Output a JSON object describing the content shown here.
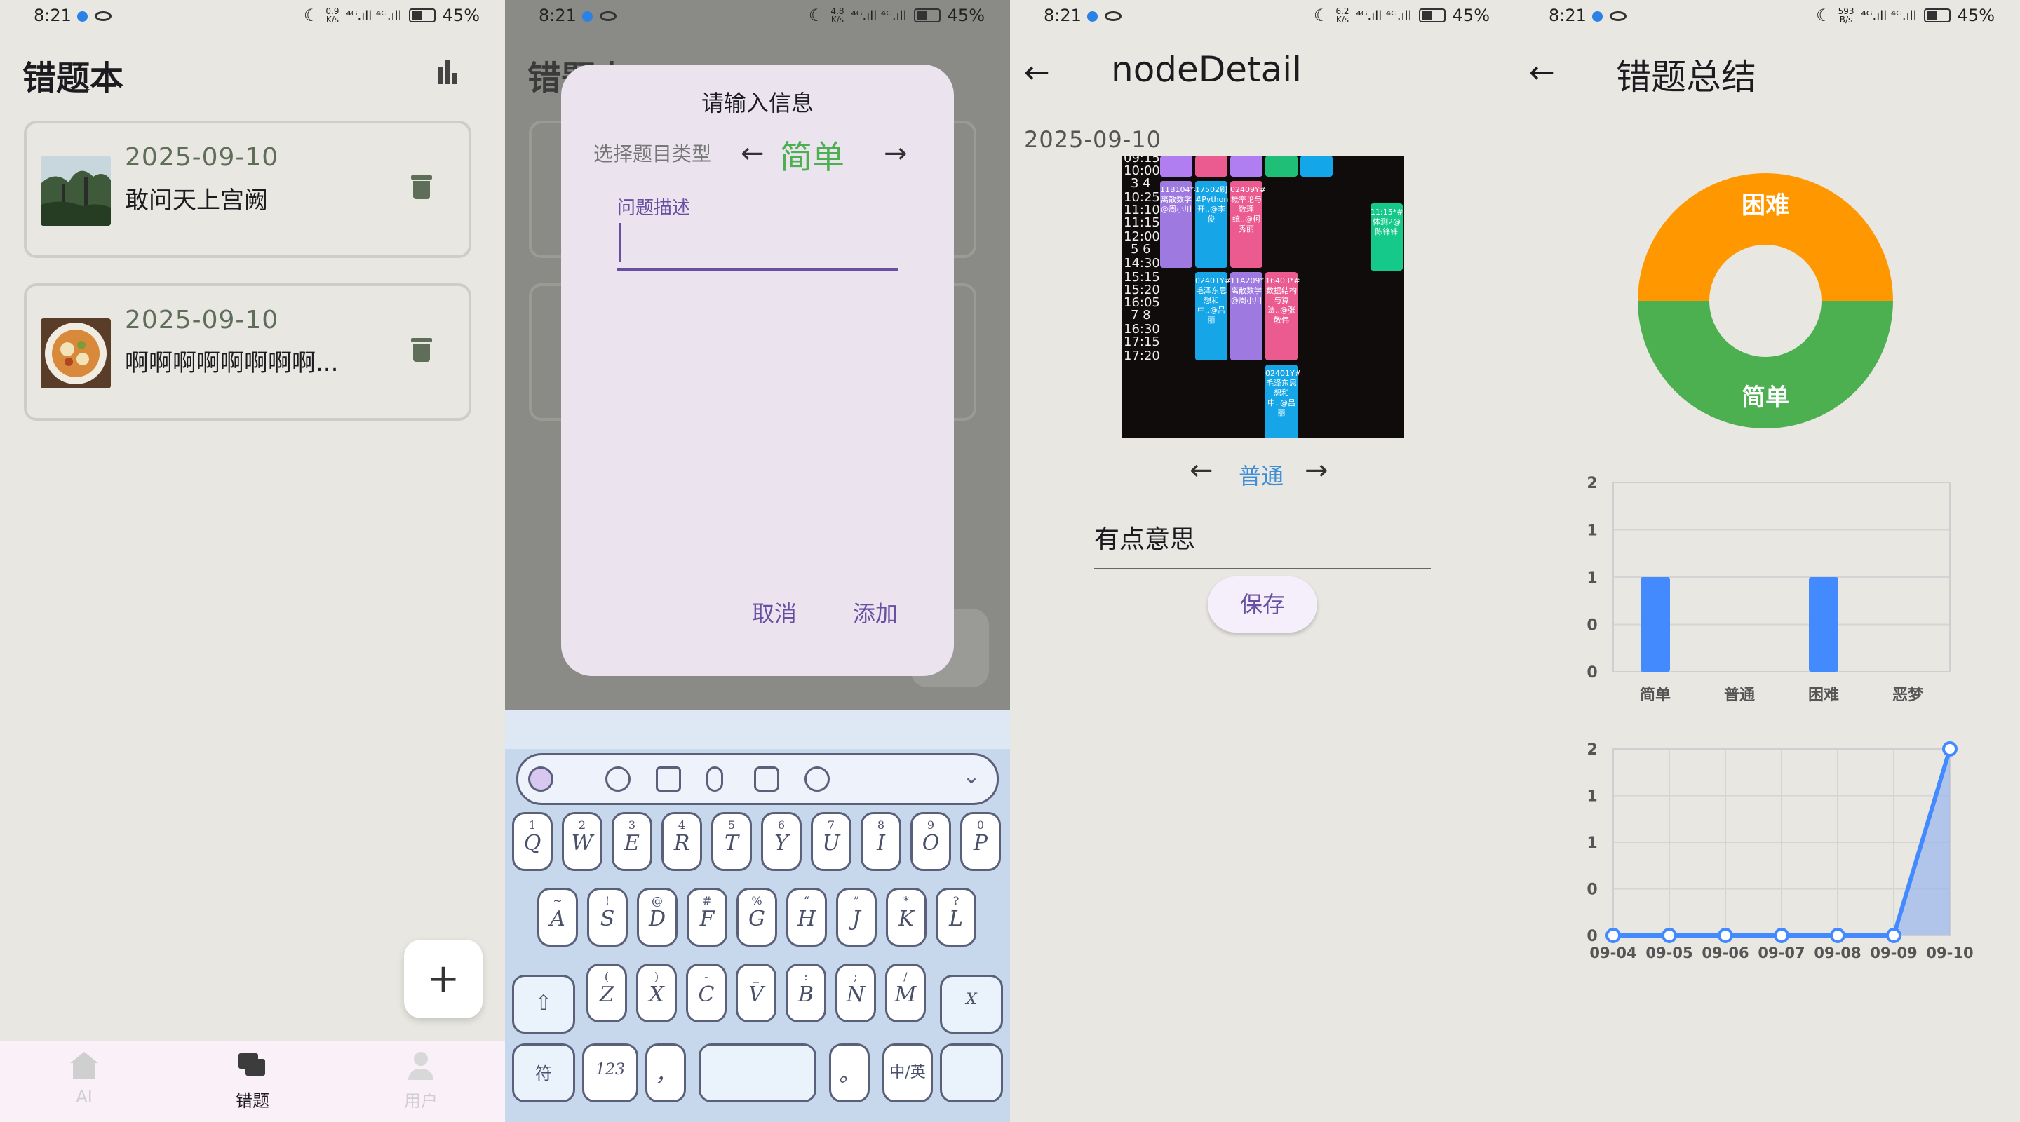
{
  "status_bar": {
    "time": "8:21",
    "battery": "45%",
    "speeds": [
      "0.9\nK/s",
      "4.8\nK/s",
      "6.2\nK/s",
      "593\nB/s"
    ],
    "signal": "⁴ᴳ.ıll ⁴ᴳ.ıll"
  },
  "screen1": {
    "title": "错题本",
    "cards": [
      {
        "date": "2025-09-10",
        "desc": "敢问天上宫阙"
      },
      {
        "date": "2025-09-10",
        "desc": "啊啊啊啊啊啊啊啊..."
      }
    ],
    "fab": "+",
    "nav": [
      {
        "label": "AI"
      },
      {
        "label": "错题"
      },
      {
        "label": "用户"
      }
    ]
  },
  "screen2": {
    "dialog_title": "请输入信息",
    "type_label": "选择题目类型",
    "type_value": "简单",
    "field_label": "问题描述",
    "cancel": "取消",
    "add": "添加",
    "keys_row1": [
      {
        "s": "1",
        "m": "Q"
      },
      {
        "s": "2",
        "m": "W"
      },
      {
        "s": "3",
        "m": "E"
      },
      {
        "s": "4",
        "m": "R"
      },
      {
        "s": "5",
        "m": "T"
      },
      {
        "s": "6",
        "m": "Y"
      },
      {
        "s": "7",
        "m": "U"
      },
      {
        "s": "8",
        "m": "I"
      },
      {
        "s": "9",
        "m": "O"
      },
      {
        "s": "0",
        "m": "P"
      }
    ],
    "keys_row2": [
      {
        "s": "~",
        "m": "A"
      },
      {
        "s": "!",
        "m": "S"
      },
      {
        "s": "@",
        "m": "D"
      },
      {
        "s": "#",
        "m": "F"
      },
      {
        "s": "%",
        "m": "G"
      },
      {
        "s": "“",
        "m": "H"
      },
      {
        "s": "”",
        "m": "J"
      },
      {
        "s": "*",
        "m": "K"
      },
      {
        "s": "?",
        "m": "L"
      }
    ],
    "keys_row3": [
      {
        "s": "(",
        "m": "Z"
      },
      {
        "s": ")",
        "m": "X"
      },
      {
        "s": "-",
        "m": "C"
      },
      {
        "s": "_",
        "m": "V"
      },
      {
        "s": ":",
        "m": "B"
      },
      {
        "s": ";",
        "m": "N"
      },
      {
        "s": "/",
        "m": "M"
      }
    ],
    "key_symbol": "符",
    "key_num": "123",
    "key_comma": "，",
    "key_period": "。",
    "key_lang": "中/英",
    "key_jelly": "X"
  },
  "screen3": {
    "title": "nodeDetail",
    "date": "2025-09-10",
    "times": [
      "09:15",
      "10:00",
      "3 4",
      "10:25",
      "11:10",
      "11:15",
      "12:00",
      "5 6",
      "14:30",
      "15:15",
      "15:20",
      "16:05",
      "7 8",
      "16:30",
      "17:15",
      "17:20"
    ],
    "blocks": [
      {
        "text": "11B104*#离散数学@周小川"
      },
      {
        "text": "17502刷#Python开..@李俊"
      },
      {
        "text": "02409Y#概率论与数理统..@柯秀丽"
      },
      {
        "text": "11:15*#体测2@陈锋锋"
      },
      {
        "text": "02401Y#毛泽东思想和中..@吕丽"
      },
      {
        "text": "11A209*#离散数学@周小川"
      },
      {
        "text": "16403*#数据结构与算法..@张敬伟"
      },
      {
        "text": "02401Y#毛泽东思想和中..@吕丽"
      }
    ],
    "level": "普通",
    "note": "有点意思",
    "save": "保存"
  },
  "screen4": {
    "title": "错题总结",
    "chart_data": [
      {
        "type": "pie",
        "categories": [
          "困难",
          "简单"
        ],
        "values": [
          1,
          1
        ],
        "colors": [
          "#ff9800",
          "#4caf50"
        ]
      },
      {
        "type": "bar",
        "categories": [
          "简单",
          "普通",
          "困难",
          "恶梦"
        ],
        "values": [
          1,
          0,
          1,
          0
        ],
        "yticks": [
          "0",
          "0",
          "1",
          "1",
          "2"
        ],
        "ylim": [
          0,
          2
        ],
        "color": "#448aff"
      },
      {
        "type": "line",
        "categories": [
          "09-04",
          "09-05",
          "09-06",
          "09-07",
          "09-08",
          "09-09",
          "09-10"
        ],
        "values": [
          0,
          0,
          0,
          0,
          0,
          0,
          2
        ],
        "yticks": [
          "0",
          "0",
          "1",
          "1",
          "2"
        ],
        "ylim": [
          0,
          2
        ],
        "color": "#448aff"
      }
    ]
  }
}
